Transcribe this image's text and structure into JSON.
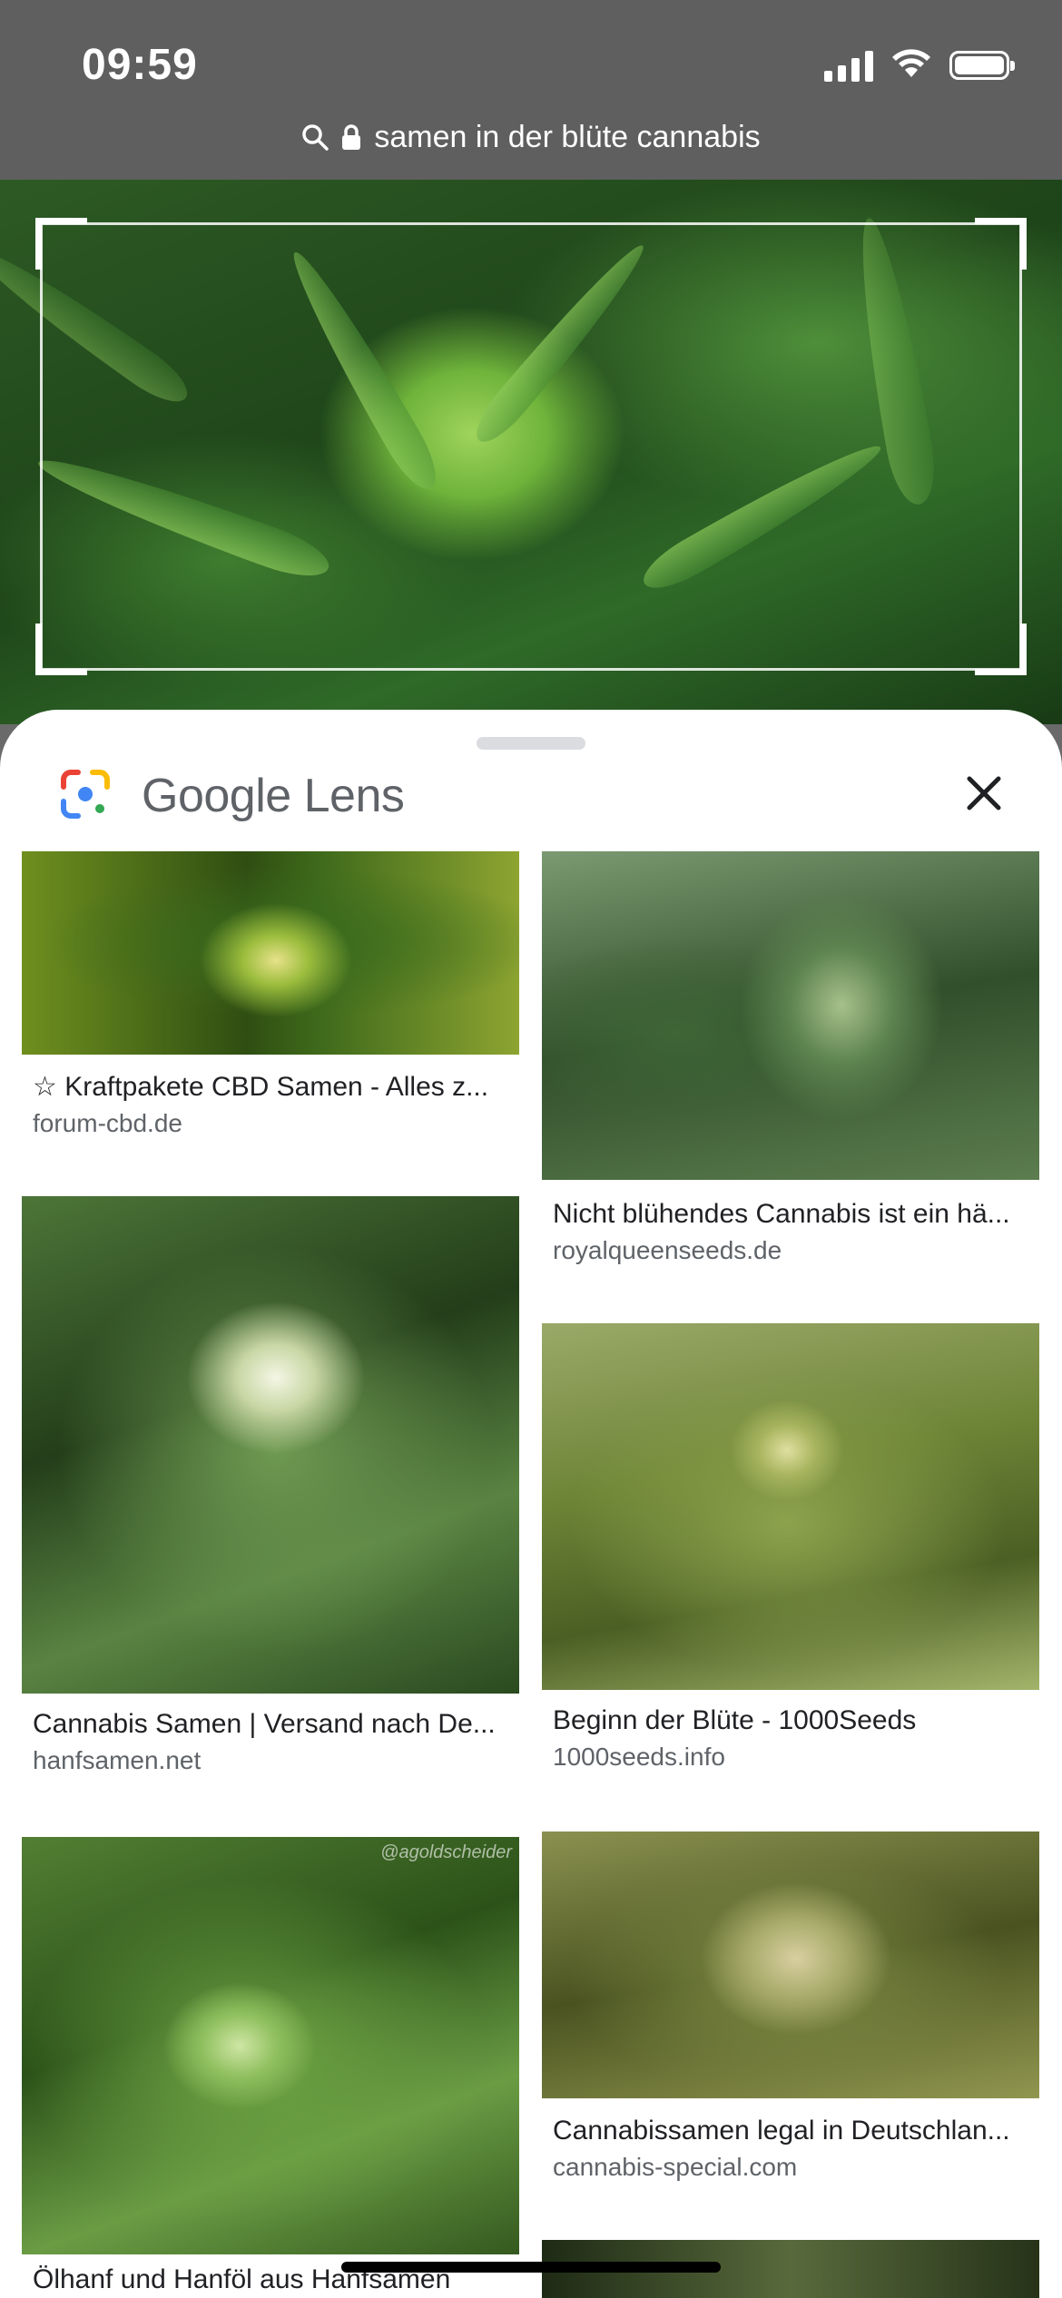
{
  "status_bar": {
    "time": "09:59"
  },
  "url_bar": {
    "query": "samen in der blüte cannabis"
  },
  "lens": {
    "title": "Google Lens"
  },
  "results": {
    "left": [
      {
        "title": "☆ Kraftpakete CBD Samen - Alles z...",
        "source": "forum-cbd.de"
      },
      {
        "title": "Cannabis Samen | Versand nach De...",
        "source": "hanfsamen.net"
      },
      {
        "title": "Ölhanf und Hanföl aus Hanfsamen",
        "source": "",
        "watermark": "@agoldscheider"
      }
    ],
    "right": [
      {
        "title": "Nicht blühendes Cannabis ist ein hä...",
        "source": "royalqueenseeds.de"
      },
      {
        "title": "Beginn der Blüte - 1000Seeds",
        "source": "1000seeds.info"
      },
      {
        "title": "Cannabissamen legal in Deutschlan...",
        "source": "cannabis-special.com"
      }
    ]
  },
  "colors": {
    "lens_title": "#5f6368",
    "source_text": "#5f6368",
    "status_bar_bg": "#5f5f5f"
  },
  "icons": [
    "signal-icon",
    "wifi-icon",
    "battery-icon",
    "search-icon",
    "lock-icon",
    "google-lens-logo-icon",
    "close-icon"
  ]
}
